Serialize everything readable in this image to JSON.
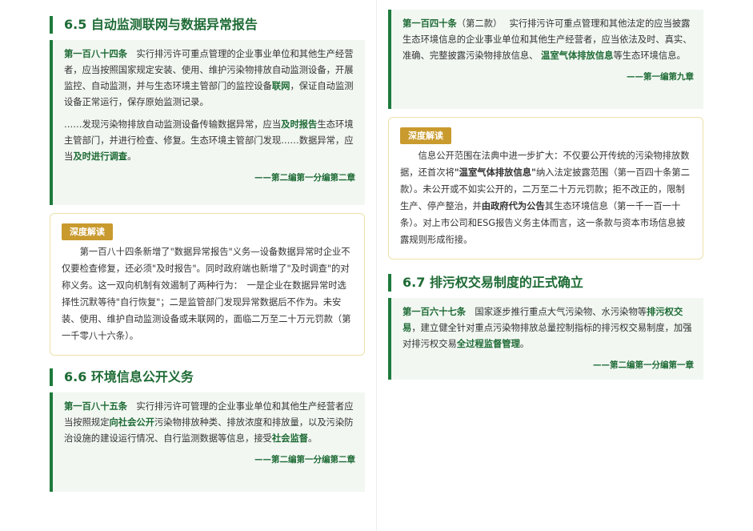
{
  "left": {
    "sec65": {
      "title": "6.5 自动监测联网与数据异常报告",
      "a1_no": "第一百八十四条",
      "a1_t1": "　实行排污许可重点管理的企业事业单位和其他生产经营者，应当按照国家规定安装、使用、维护污染物排放自动监测设备，开展监控、自动监测，并与生态环境主管部门的监控设备",
      "a1_h1": "联网",
      "a1_t2": "，保证自动监测设备正常运行，保存原始监测记录。",
      "a1_t3": "……发现污染物排放自动监测设备传输数据异常，应当",
      "a1_h2": "及时报告",
      "a1_t4": "生态环境主管部门，并进行检查、修复。生态环境主管部门发现……数据异常，应当",
      "a1_h3": "及时进行调查",
      "a1_t5": "。",
      "a1_src": "——第二编第一分编第二章",
      "an_badge": "深度解读",
      "an_text": "第一百八十四条新增了\"数据异常报告\"义务—设备数据异常时企业不仅要检查修复，还必须\"及时报告\"。同时政府端也新增了\"及时调查\"的对称义务。这一双向机制有效遏制了两种行为：　一是企业在数据异常时选择性沉默等待\"自行恢复\"；二是监管部门发现异常数据后不作为。未安装、使用、维护自动监测设备或未联网的，面临二万至二十万元罚款（第一千零八十六条）。"
    },
    "sec66": {
      "title": "6.6 环境信息公开义务",
      "a_no": "第一百八十五条",
      "a_t1": "　实行排污许可管理的企业事业单位和其他生产经营者应当按照规定",
      "a_h1": "向社会公开",
      "a_t2": "污染物排放种类、排放浓度和排放量，以及污染防治设施的建设运行情况、自行监测数据等信息，接受",
      "a_h2": "社会监督",
      "a_t3": "。",
      "a_src": "——第二编第一分编第二章"
    }
  },
  "right": {
    "a140_no": "第一百四十条",
    "a140_sub": "（第二款）",
    "a140_t1": "　 实行排污许可重点管理和其他法定的应当披露生态环境信息的企业事业单位和其他生产经营者，应当依法及时、真实、准确、完整披露污染物排放信息、 ",
    "a140_h1": "温室气体排放信息",
    "a140_t2": "等生态环境信息。",
    "a140_src": "——第一编第九章",
    "an_badge": "深度解读",
    "an_t1": "信息公开范围在法典中进一步扩大：不仅要公开传统的污染物排放数据，还首次将",
    "an_b1": "\"温室气体排放信息\"",
    "an_t2": "纳入法定披露范围（第一百四十条第二款）。未公开或不如实公开的，二万至二十万元罚款；拒不改正的，限制生产、停产整治，并",
    "an_b2": "由政府代为公告",
    "an_t3": "其生态环境信息（第一千一百一十条）。对上市公司和ESG报告义务主体而言，这一条款与资本市场信息披露规则形成衔接。",
    "sec67": {
      "title": "6.7 排污权交易制度的正式确立",
      "a_no": "第一百六十七条",
      "a_t1": "　国家逐步推行重点大气污染物、水污染物等",
      "a_h1": "排污权交易",
      "a_t2": "，建立健全针对重点污染物排放总量控制指标的排污权交易制度，加强对排污权交易",
      "a_h2": "全过程监督管理",
      "a_t3": "。",
      "a_src": "——第二编第一分编第一章"
    }
  }
}
